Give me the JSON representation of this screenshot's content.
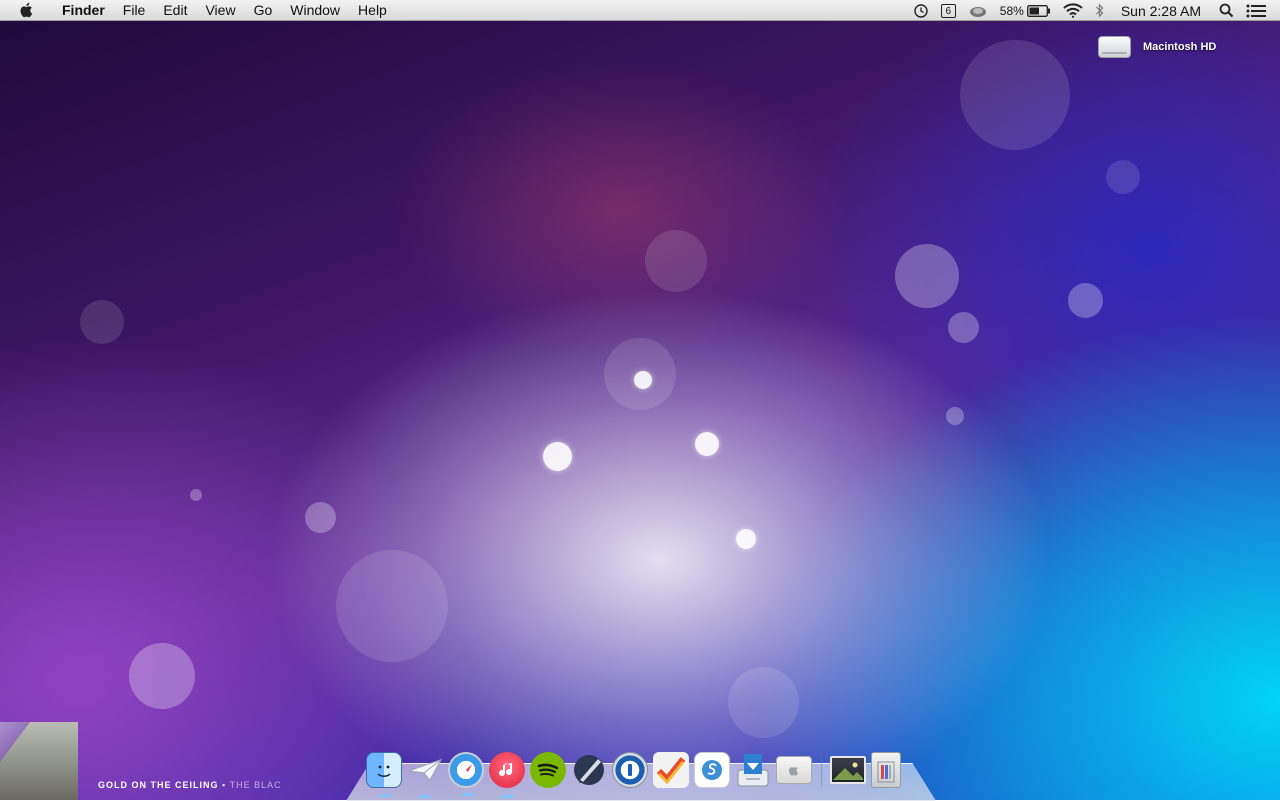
{
  "menubar": {
    "app_name": "Finder",
    "menus": [
      "File",
      "Edit",
      "View",
      "Go",
      "Window",
      "Help"
    ],
    "status": {
      "calendar_day": "6",
      "battery_percent": "58%",
      "clock": "Sun 2:28 AM"
    },
    "icons": [
      "apple-icon",
      "timemachine-icon",
      "calendar-icon",
      "cloud-icon",
      "battery-icon",
      "wifi-icon",
      "bluetooth-icon",
      "spotlight-icon",
      "notification-center-icon"
    ]
  },
  "desktop": {
    "drive_label": "Macintosh HD",
    "now_playing": {
      "title": "GOLD ON THE CEILING",
      "separator": " • ",
      "artist": "THE BLAC"
    }
  },
  "dock": {
    "apps": [
      "finder-icon",
      "mail-icon",
      "safari-icon",
      "itunes-icon",
      "spotify-icon",
      "pencil-app-icon",
      "onepassword-icon",
      "omnifocus-icon",
      "simplenote-icon",
      "installer-icon",
      "app-store-icon"
    ],
    "stacks": [
      "photo-stack-icon",
      "trash-icon"
    ]
  }
}
